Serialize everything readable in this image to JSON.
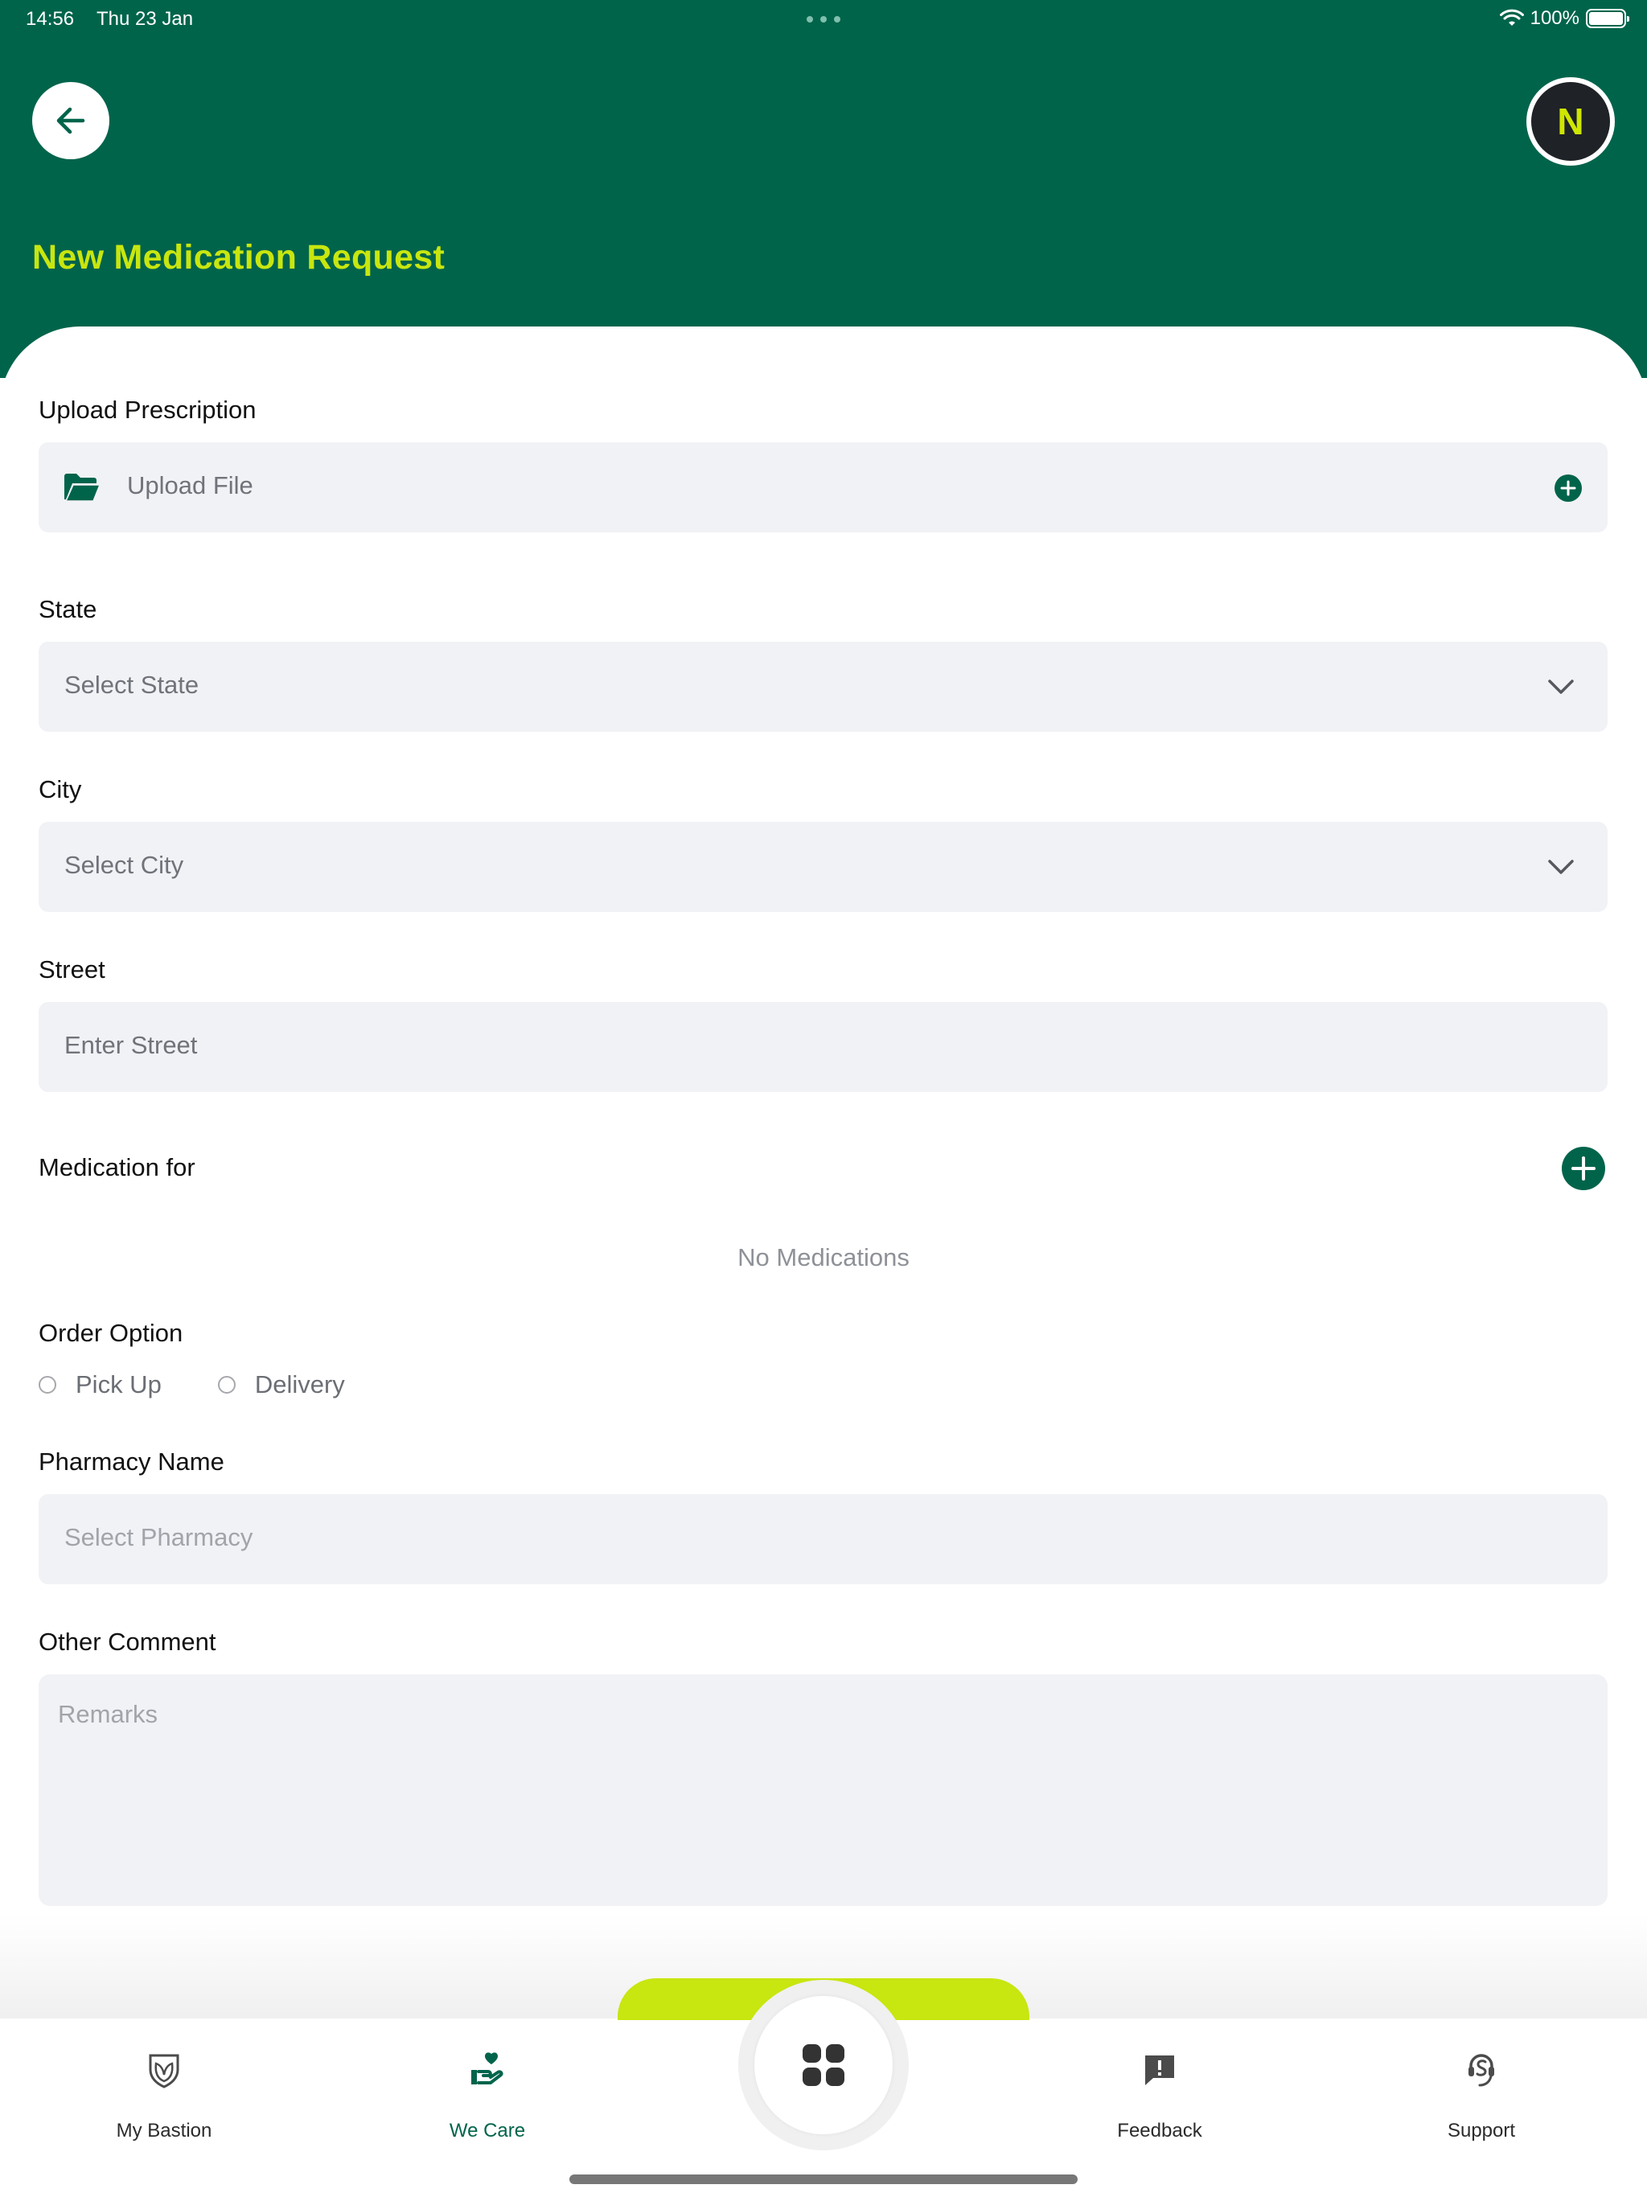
{
  "status_bar": {
    "time": "14:56",
    "date": "Thu 23 Jan",
    "battery": "100%"
  },
  "header": {
    "title": "New Medication Request",
    "avatar_initial": "N",
    "back_icon": "arrow-left-icon"
  },
  "form": {
    "upload_prescription": {
      "label": "Upload Prescription",
      "button_text": "Upload File",
      "icon": "folder-open-icon"
    },
    "state": {
      "label": "State",
      "placeholder": "Select State"
    },
    "city": {
      "label": "City",
      "placeholder": "Select City"
    },
    "street": {
      "label": "Street",
      "placeholder": "Enter Street"
    },
    "medication_for": {
      "label": "Medication for",
      "empty_text": "No Medications"
    },
    "order_option": {
      "label": "Order Option",
      "options": [
        "Pick Up",
        "Delivery"
      ]
    },
    "pharmacy_name": {
      "label": "Pharmacy Name",
      "placeholder": "Select Pharmacy"
    },
    "other_comment": {
      "label": "Other Comment",
      "placeholder": "Remarks"
    }
  },
  "bottom_nav": {
    "tabs": [
      {
        "label": "My Bastion",
        "icon": "shield-leaf-icon"
      },
      {
        "label": "We Care",
        "icon": "hand-heart-icon",
        "active": true
      },
      {
        "label": "Feedback",
        "icon": "feedback-icon"
      },
      {
        "label": "Support",
        "icon": "headset-icon"
      }
    ],
    "center_icon": "grid-icon"
  },
  "colors": {
    "primary": "#00644b",
    "accent": "#c8e60f",
    "field_bg": "#f1f2f5"
  }
}
